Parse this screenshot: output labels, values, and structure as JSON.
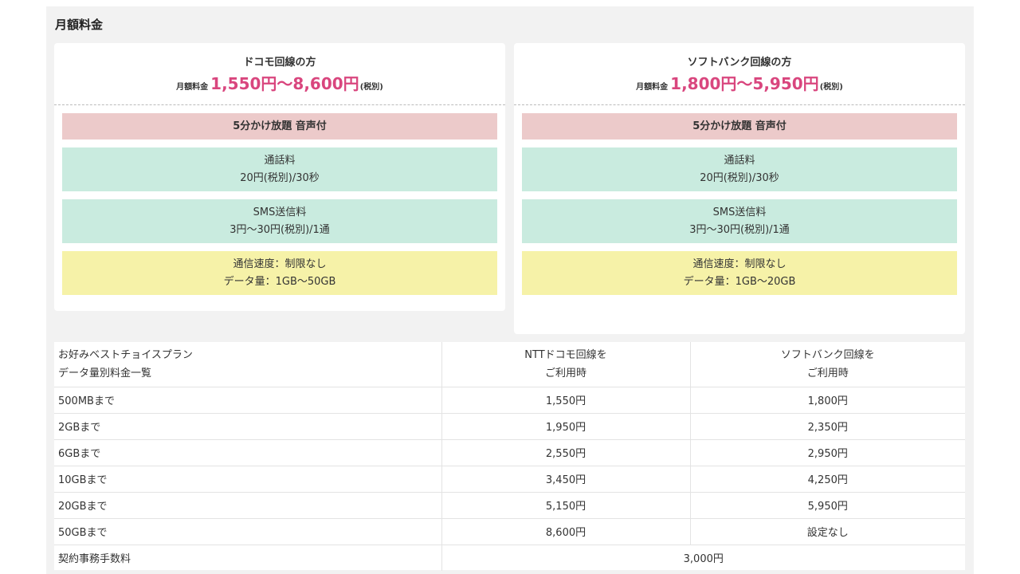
{
  "section": {
    "title": "月額料金"
  },
  "plans": [
    {
      "name": "ドコモ回線の方",
      "price_label": "月額料金",
      "price": "1,550円〜8,600円",
      "tax": "(税別)",
      "plan_name": "5分かけ放題 音声付",
      "call_title": "通話料",
      "call_value": "20円(税別)/30秒",
      "sms_title": "SMS送信料",
      "sms_value": "3円〜30円(税別)/1通",
      "speed": "通信速度：制限なし",
      "data": "データ量：1GB〜50GB"
    },
    {
      "name": "ソフトバンク回線の方",
      "price_label": "月額料金",
      "price": "1,800円〜5,950円",
      "tax": "(税別)",
      "plan_name": "5分かけ放題 音声付",
      "call_title": "通話料",
      "call_value": "20円(税別)/30秒",
      "sms_title": "SMS送信料",
      "sms_value": "3円〜30円(税別)/1通",
      "speed": "通信速度：制限なし",
      "data": "データ量：1GB〜20GB"
    }
  ],
  "table": {
    "header": {
      "col1_line1": "お好みベストチョイスプラン",
      "col1_line2": "データ量別料金一覧",
      "col2_line1": "NTTドコモ回線を",
      "col2_line2": "ご利用時",
      "col3_line1": "ソフトバンク回線を",
      "col3_line2": "ご利用時"
    },
    "rows": [
      {
        "label": "500MBまで",
        "docomo": "1,550円",
        "softbank": "1,800円"
      },
      {
        "label": "2GBまで",
        "docomo": "1,950円",
        "softbank": "2,350円"
      },
      {
        "label": "6GBまで",
        "docomo": "2,550円",
        "softbank": "2,950円"
      },
      {
        "label": "10GBまで",
        "docomo": "3,450円",
        "softbank": "4,250円"
      },
      {
        "label": "20GBまで",
        "docomo": "5,150円",
        "softbank": "5,950円"
      },
      {
        "label": "50GBまで",
        "docomo": "8,600円",
        "softbank": "設定なし"
      }
    ],
    "fee": {
      "label": "契約事務手数料",
      "value": "3,000円"
    }
  },
  "colors": {
    "price": "#d9467e",
    "plan_bg": "#eccaca",
    "green_bg": "#c9ebdf",
    "yellow_bg": "#f6f2a8",
    "panel_bg": "#f2f2f2"
  }
}
